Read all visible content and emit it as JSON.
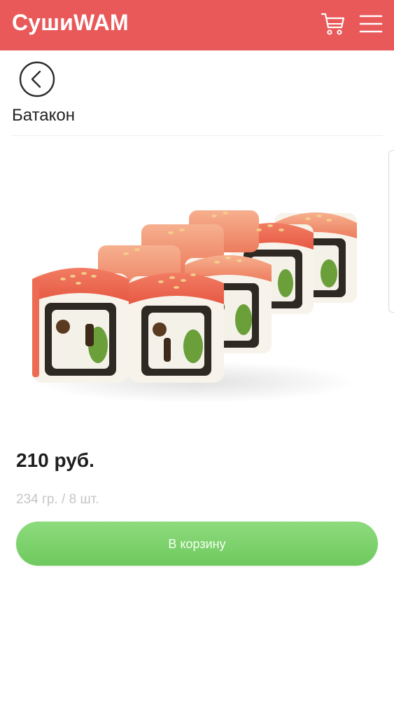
{
  "header": {
    "logo": "СушиWAM",
    "cart_icon": "cart-icon",
    "menu_icon": "hamburger-menu-icon"
  },
  "nav": {
    "back_icon": "chevron-left-circle-icon"
  },
  "product": {
    "title": "Батакон",
    "price": "210 руб.",
    "weight": "234 гр. / 8 шт.",
    "add_to_cart_label": "В корзину"
  },
  "colors": {
    "header_bg": "#e95959",
    "button_green": "#7cd36b",
    "price_text": "#1e1e1e",
    "muted_text": "#c5c5c5"
  }
}
